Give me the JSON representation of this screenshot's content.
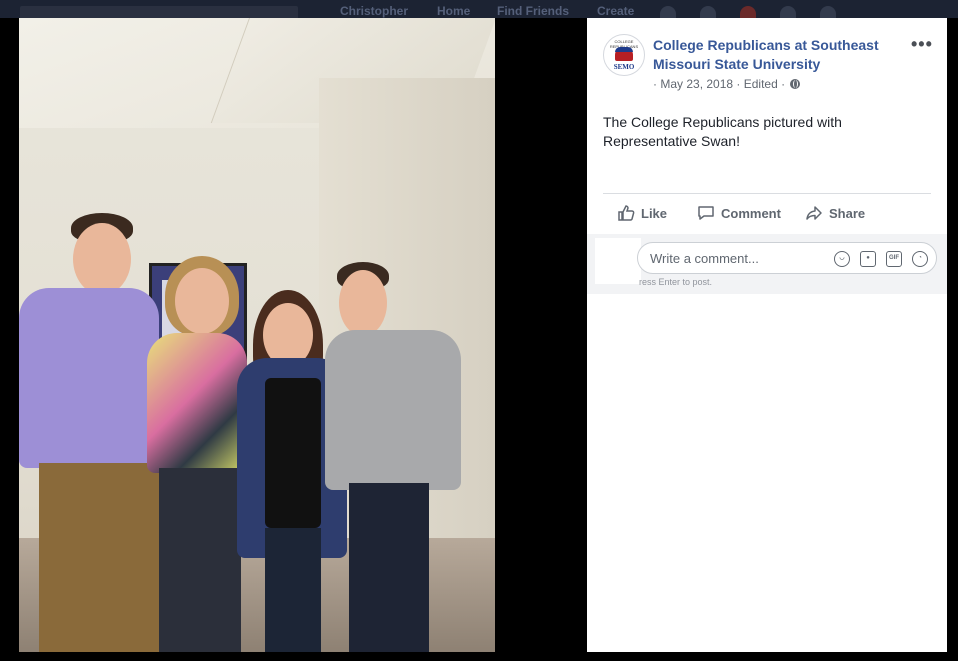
{
  "nav": {
    "items": [
      "Christopher",
      "Home",
      "Find Friends",
      "Create"
    ]
  },
  "post": {
    "page_name": "College Republicans at Southeast Missouri State University",
    "date": "May 23, 2018",
    "edited": "Edited",
    "text": "The College Republicans pictured with Representative Swan!",
    "more_label": "•••",
    "avatar_text": "SEMO",
    "avatar_top_text": "COLLEGE REPUBLICANS"
  },
  "actions": {
    "like": "Like",
    "comment": "Comment",
    "share": "Share"
  },
  "comment": {
    "placeholder": "Write a comment...",
    "hint": "ress Enter to post."
  },
  "colors": {
    "link": "#385898",
    "accent": "#606770"
  },
  "icons": [
    "globe-icon",
    "like-icon",
    "comment-icon",
    "share-icon",
    "emoji-icon",
    "camera-icon",
    "gif-icon",
    "sticker-icon"
  ]
}
